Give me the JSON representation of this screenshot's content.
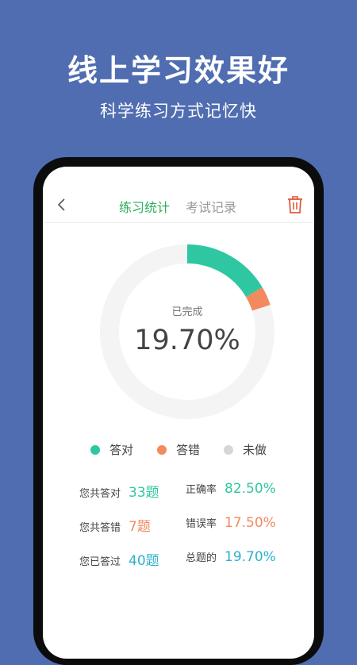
{
  "headline": "线上学习效果好",
  "subline": "科学练习方式记忆快",
  "topbar": {
    "tabs": [
      {
        "label": "练习统计",
        "active": true
      },
      {
        "label": "考试记录",
        "active": false
      }
    ]
  },
  "progress": {
    "label": "已完成",
    "value_text": "19.70%",
    "correct_fraction": 0.165,
    "wrong_fraction": 0.035
  },
  "legend": [
    {
      "label": "答对",
      "color": "#2fc7a2"
    },
    {
      "label": "答错",
      "color": "#f2895f"
    },
    {
      "label": "未做",
      "color": "#d6d6d6"
    }
  ],
  "stats": [
    {
      "label": "您共答对",
      "value": "33题",
      "color": "#2fc7a2"
    },
    {
      "label": "正确率",
      "value": "82.50%",
      "color": "#2fc7a2"
    },
    {
      "label": "您共答错",
      "value": "7题",
      "color": "#f2895f"
    },
    {
      "label": "错误率",
      "value": "17.50%",
      "color": "#f2895f"
    },
    {
      "label": "您已答过",
      "value": "40题",
      "color": "#2fb2cc"
    },
    {
      "label": "总题的",
      "value": "19.70%",
      "color": "#2fb2cc"
    }
  ],
  "colors": {
    "background": "#4f6db0",
    "active_tab": "#2eae5c",
    "trash": "#e05a3a",
    "ring_track": "#f4f4f4"
  }
}
